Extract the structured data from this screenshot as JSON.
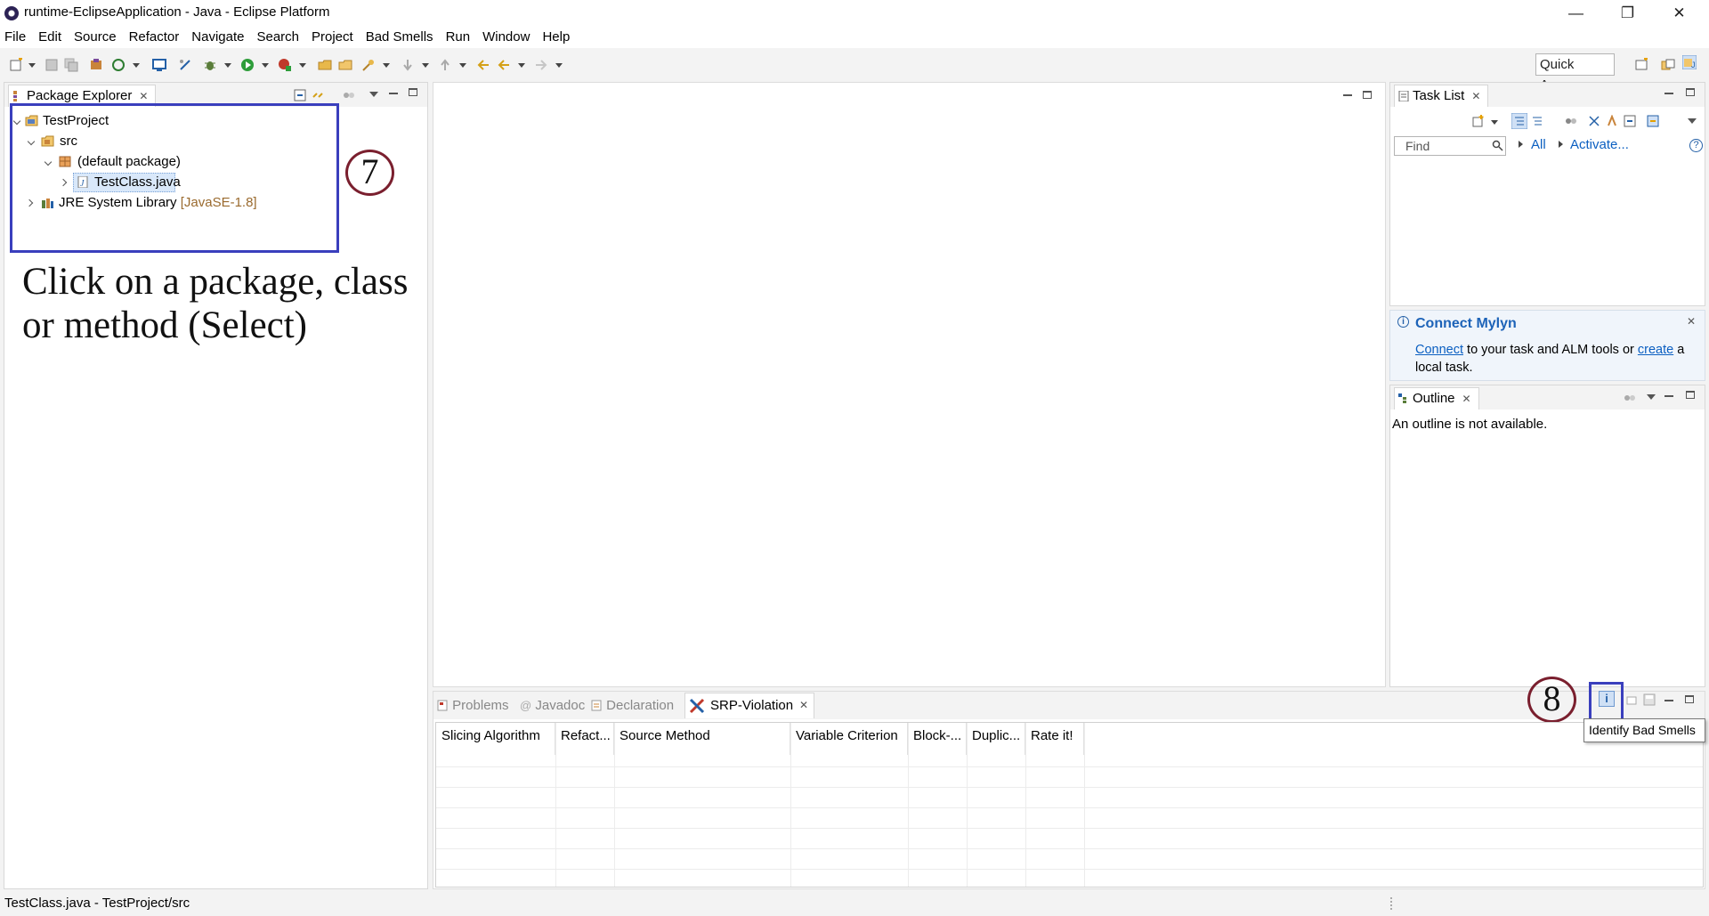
{
  "window": {
    "title": "runtime-EclipseApplication - Java - Eclipse Platform",
    "minimize": "—",
    "restore": "❐",
    "close": "✕"
  },
  "menu": [
    "File",
    "Edit",
    "Source",
    "Refactor",
    "Navigate",
    "Search",
    "Project",
    "Bad Smells",
    "Run",
    "Window",
    "Help"
  ],
  "toolbar": {
    "quick_access": "Quick Access"
  },
  "package_explorer": {
    "tab_label": "Package Explorer",
    "tree": {
      "project": "TestProject",
      "src": "src",
      "package": "(default package)",
      "class": "TestClass.java",
      "library": "JRE System Library",
      "library_version": "[JavaSE-1.8]"
    }
  },
  "annotations": {
    "step7": "7",
    "step8": "8",
    "instruction": "Click on a package, class\nor  method (Select)"
  },
  "task_list": {
    "tab_label": "Task List",
    "find_placeholder": "Find",
    "all_label": "All",
    "activate_label": "Activate...",
    "help": "?"
  },
  "mylyn": {
    "title": "Connect Mylyn",
    "connect_link": "Connect",
    "text_mid": " to your task and ALM tools or ",
    "create_link": "create",
    "text_end": " a local task."
  },
  "outline": {
    "tab_label": "Outline",
    "message": "An outline is not available."
  },
  "bottom_panel": {
    "tabs": {
      "problems": "Problems",
      "javadoc": "Javadoc",
      "declaration": "Declaration",
      "srp": "SRP-Violation"
    },
    "columns": [
      "Slicing Algorithm",
      "Refact...",
      "Source Method",
      "Variable Criterion",
      "Block-...",
      "Duplic...",
      "Rate it!"
    ],
    "identify_button": "i",
    "tooltip": "Identify Bad Smells"
  },
  "status_bar": {
    "text": "TestClass.java - TestProject/src"
  },
  "colors": {
    "annotation_box": "#3a3fbd",
    "annotation_circle": "#7a1f2e",
    "link": "#0b5fc1",
    "library_version": "#9a6a2e"
  }
}
